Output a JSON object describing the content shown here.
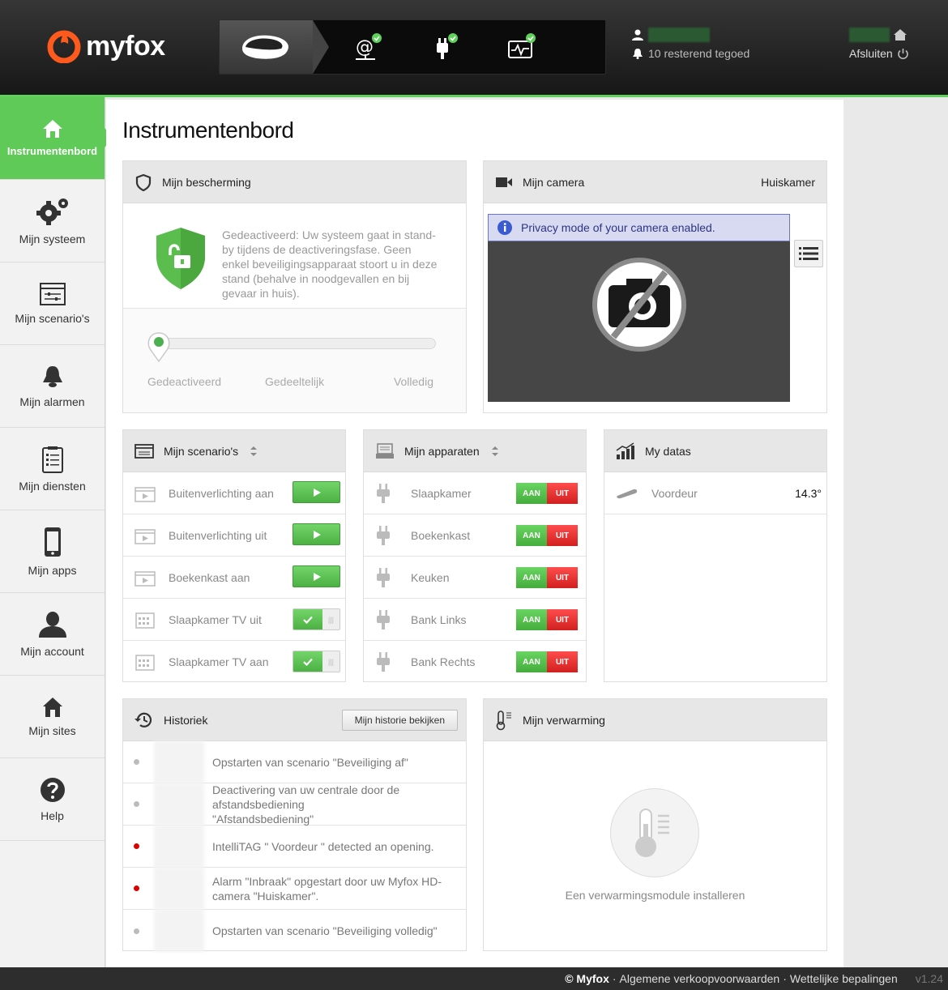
{
  "header": {
    "logo_text": "myfox",
    "user": {
      "credit": "10 resterend tegoed"
    },
    "logout_label": "Afsluiten"
  },
  "sidebar": {
    "items": [
      {
        "label": "Instrumentenbord",
        "icon": "home-icon",
        "active": true
      },
      {
        "label": "Mijn systeem",
        "icon": "gears-icon"
      },
      {
        "label": "Mijn scenario's",
        "icon": "scenario-icon"
      },
      {
        "label": "Mijn alarmen",
        "icon": "bell-icon"
      },
      {
        "label": "Mijn diensten",
        "icon": "clipboard-icon"
      },
      {
        "label": "Mijn apps",
        "icon": "phone-icon"
      },
      {
        "label": "Mijn account",
        "icon": "user-icon"
      },
      {
        "label": "Mijn sites",
        "icon": "house-icon"
      },
      {
        "label": "Help",
        "icon": "help-icon"
      }
    ]
  },
  "page": {
    "title": "Instrumentenbord"
  },
  "protection": {
    "title": "Mijn bescherming",
    "description": "Gedeactiveerd: Uw systeem gaat in stand-by tijdens de deactiveringsfase. Geen enkel beveiligingsapparaat stoort u in deze stand (behalve in noodgevallen en bij gevaar in huis).",
    "levels": [
      "Gedeactiveerd",
      "Gedeeltelijk",
      "Volledig"
    ],
    "current_level": 0
  },
  "camera": {
    "title": "Mijn camera",
    "location": "Huiskamer",
    "notice": "Privacy mode of your camera enabled."
  },
  "scenarios": {
    "title": "Mijn scenario's",
    "items": [
      {
        "label": "Buitenverlichting aan",
        "type": "play"
      },
      {
        "label": "Buitenverlichting uit",
        "type": "play"
      },
      {
        "label": "Boekenkast aan",
        "type": "play"
      },
      {
        "label": "Slaapkamer TV uit",
        "type": "toggle"
      },
      {
        "label": "Slaapkamer TV aan",
        "type": "toggle"
      }
    ]
  },
  "devices": {
    "title": "Mijn apparaten",
    "on_label": "AAN",
    "off_label": "UIT",
    "items": [
      {
        "label": "Slaapkamer"
      },
      {
        "label": "Boekenkast"
      },
      {
        "label": "Keuken"
      },
      {
        "label": "Bank Links"
      },
      {
        "label": "Bank Rechts"
      }
    ]
  },
  "datas": {
    "title": "My datas",
    "items": [
      {
        "label": "Voordeur",
        "value": "14.3°"
      }
    ]
  },
  "history": {
    "title": "Historiek",
    "button_label": "Mijn historie bekijken",
    "items": [
      {
        "text": "Opstarten van scenario \"Beveiliging af\"",
        "color": "#bbbbbb"
      },
      {
        "text": "Deactivering van uw centrale door de afstandsbediening \"Afstandsbediening\"",
        "color": "#bbbbbb"
      },
      {
        "text": "IntelliTAG \" Voordeur \" detected an opening.",
        "color": "#dd0000"
      },
      {
        "text": "Alarm \"Inbraak\" opgestart door uw Myfox HD-camera \"Huiskamer\".",
        "color": "#dd0000"
      },
      {
        "text": "Opstarten van scenario \"Beveiliging volledig\"",
        "color": "#bbbbbb"
      }
    ]
  },
  "heating": {
    "title": "Mijn verwarming",
    "install_label": "Een verwarmingsmodule installeren"
  },
  "footer": {
    "brand": "© Myfox",
    "terms": "Algemene verkoopvoorwaarden",
    "legal": "Wettelijke bepalingen",
    "version": "v1.24"
  },
  "colors": {
    "accent": "#5fca58",
    "alert": "#dd0000",
    "off_red": "#e52626"
  }
}
